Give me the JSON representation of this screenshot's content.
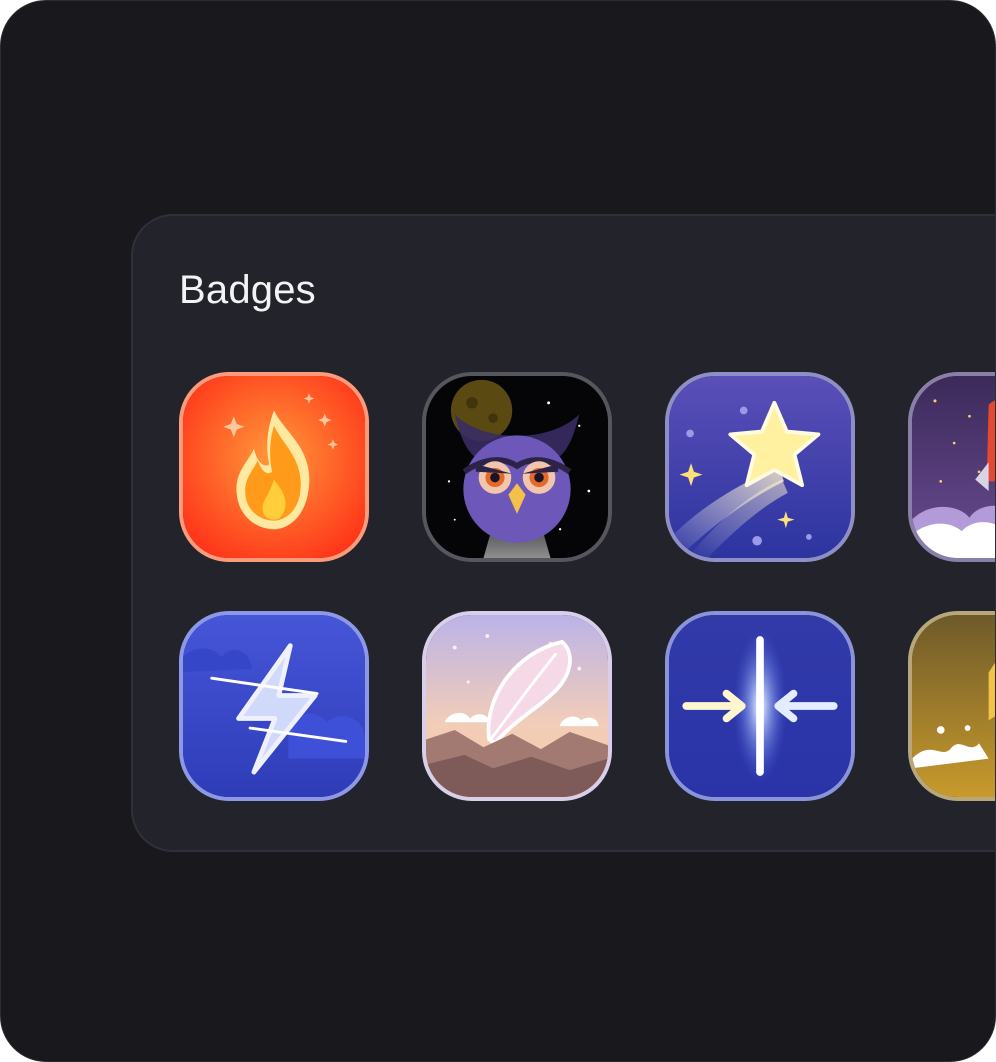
{
  "panel": {
    "title": "Badges"
  },
  "badges": [
    {
      "icon": "fire-icon",
      "colors": [
        "#ff3b1f",
        "#ff7a2a"
      ]
    },
    {
      "icon": "owl-icon",
      "colors": [
        "#000000",
        "#6b4fb8"
      ]
    },
    {
      "icon": "shooting-star-icon",
      "colors": [
        "#3a3c9e",
        "#6a5fc8"
      ]
    },
    {
      "icon": "rocket-icon",
      "colors": [
        "#4a3468",
        "#ffffff"
      ]
    },
    {
      "icon": "lightning-bolt-icon",
      "colors": [
        "#2f3ec0",
        "#5a6ff0"
      ]
    },
    {
      "icon": "feather-icon",
      "colors": [
        "#c7bde8",
        "#f6c9a8"
      ]
    },
    {
      "icon": "converging-arrows-icon",
      "colors": [
        "#2b35a8",
        "#ffffff"
      ]
    },
    {
      "icon": "splash-icon",
      "colors": [
        "#7a6530",
        "#c89a2c"
      ]
    }
  ]
}
